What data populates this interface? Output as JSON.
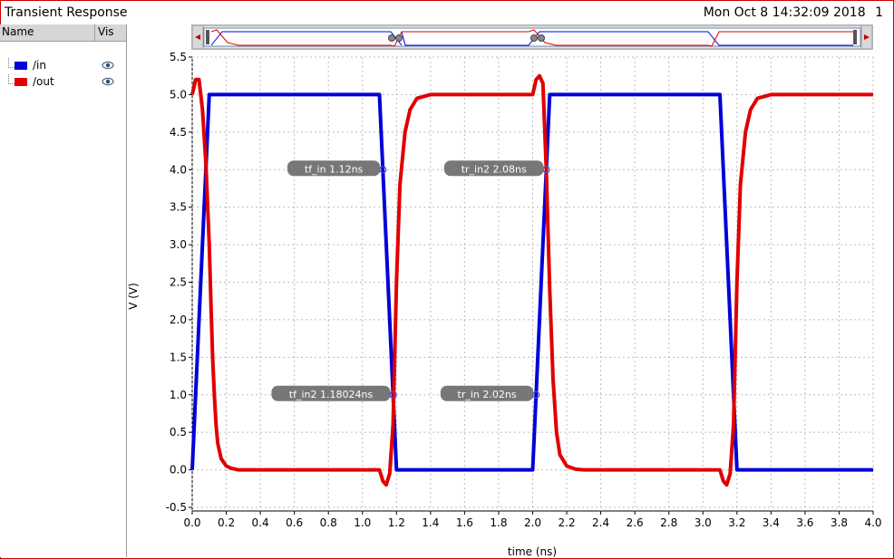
{
  "window": {
    "title": "Transient Response",
    "datetime": "Mon Oct 8 14:32:09 2018",
    "page_index": "1"
  },
  "legend": {
    "header_name": "Name",
    "header_vis": "Vis",
    "items": [
      {
        "label": "/in",
        "color": "#0000d8",
        "visible_icon": "eye-icon"
      },
      {
        "label": "/out",
        "color": "#e00000",
        "visible_icon": "eye-icon"
      }
    ]
  },
  "chart_data": {
    "type": "line",
    "title": "",
    "xlabel": "time (ns)",
    "ylabel": "V (V)",
    "xlim": [
      0.0,
      4.0
    ],
    "ylim": [
      -0.5,
      5.5
    ],
    "xticks": [
      "0.0",
      "0.2",
      "0.4",
      "0.6",
      "0.8",
      "1.0",
      "1.2",
      "1.4",
      "1.6",
      "1.8",
      "2.0",
      "2.2",
      "2.4",
      "2.6",
      "2.8",
      "3.0",
      "3.2",
      "3.4",
      "3.6",
      "3.8",
      "4.0"
    ],
    "yticks": [
      "-0.5",
      "0.0",
      "0.5",
      "1.0",
      "1.5",
      "2.0",
      "2.5",
      "3.0",
      "3.5",
      "4.0",
      "4.5",
      "5.0",
      "5.5"
    ],
    "grid": true,
    "series": [
      {
        "name": "/in",
        "color": "#0000d8",
        "x": [
          0.0,
          0.1,
          1.1,
          1.2,
          2.0,
          2.1,
          3.1,
          3.2,
          4.0
        ],
        "y": [
          0.0,
          5.0,
          5.0,
          0.0,
          0.0,
          5.0,
          5.0,
          0.0,
          0.0
        ]
      },
      {
        "name": "/out",
        "color": "#e00000",
        "x": [
          0.0,
          0.02,
          0.04,
          0.06,
          0.08,
          0.1,
          0.11,
          0.12,
          0.13,
          0.14,
          0.15,
          0.17,
          0.2,
          0.23,
          0.27,
          0.35,
          1.0,
          1.1,
          1.12,
          1.14,
          1.16,
          1.18,
          1.2,
          1.22,
          1.25,
          1.28,
          1.32,
          1.4,
          1.5,
          2.0,
          2.02,
          2.04,
          2.06,
          2.08,
          2.1,
          2.12,
          2.14,
          2.16,
          2.2,
          2.25,
          2.3,
          2.4,
          3.0,
          3.1,
          3.12,
          3.14,
          3.16,
          3.18,
          3.2,
          3.22,
          3.25,
          3.28,
          3.32,
          3.4,
          3.5,
          4.0
        ],
        "y": [
          5.0,
          5.2,
          5.2,
          4.8,
          4.1,
          3.0,
          2.2,
          1.5,
          1.0,
          0.6,
          0.35,
          0.15,
          0.05,
          0.02,
          0.0,
          0.0,
          0.0,
          0.0,
          -0.15,
          -0.2,
          -0.05,
          0.6,
          2.5,
          3.8,
          4.5,
          4.8,
          4.95,
          5.0,
          5.0,
          5.0,
          5.2,
          5.25,
          5.15,
          4.0,
          2.4,
          1.2,
          0.5,
          0.2,
          0.05,
          0.01,
          0.0,
          0.0,
          0.0,
          0.0,
          -0.15,
          -0.2,
          -0.05,
          0.6,
          2.5,
          3.8,
          4.5,
          4.8,
          4.95,
          5.0,
          5.0,
          5.0
        ]
      }
    ],
    "markers": [
      {
        "label": "tf_in 1.12ns",
        "x": 1.12,
        "y": 4.0
      },
      {
        "label": "tr_in2 2.08ns",
        "x": 2.08,
        "y": 4.0
      },
      {
        "label": "tf_in2 1.18024ns",
        "x": 1.18024,
        "y": 1.0
      },
      {
        "label": "tr_in 2.02ns",
        "x": 2.02,
        "y": 1.0
      }
    ]
  }
}
